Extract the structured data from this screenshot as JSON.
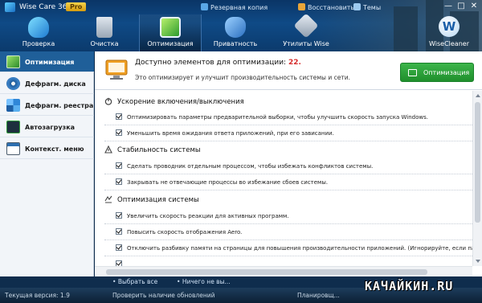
{
  "window": {
    "app_title": "Wise Care 365",
    "edition_badge": "Pro",
    "links": [
      "Резервная копия",
      "Восстановить",
      "Темы"
    ],
    "controls": [
      "—",
      "□",
      "✕"
    ]
  },
  "nav": {
    "items": [
      {
        "label": "Проверка",
        "icon": "shield-check-icon"
      },
      {
        "label": "Очистка",
        "icon": "trash-icon"
      },
      {
        "label": "Оптимизация",
        "icon": "monitor-tune-icon",
        "active": true
      },
      {
        "label": "Приватность",
        "icon": "privacy-shield-icon"
      },
      {
        "label": "Утилиты Wise",
        "icon": "tools-icon"
      }
    ],
    "brand": "WiseCleaner",
    "brand_letter": "W"
  },
  "sidebar": {
    "items": [
      {
        "label": "Оптимизация",
        "icon": "optimize-icon",
        "active": true
      },
      {
        "label": "Дефрагм. диска",
        "icon": "disk-defrag-icon"
      },
      {
        "label": "Дефрагм. реестра",
        "icon": "registry-defrag-icon"
      },
      {
        "label": "Автозагрузка",
        "icon": "startup-icon"
      },
      {
        "label": "Контекст. меню",
        "icon": "context-menu-icon"
      }
    ]
  },
  "summary": {
    "title": "Доступно элементов для оптимизации:",
    "count": "22.",
    "description": "Это оптимизирует и улучшит производительность системы и сети.",
    "button_label": "Оптимизация"
  },
  "sections": [
    {
      "title": "Ускорение включения/выключения",
      "icon": "power-icon",
      "options": [
        "Оптимизировать параметры предварительной выборки, чтобы улучшить скорость запуска Windows.",
        "Уменьшить время ожидания ответа приложений, при его зависании."
      ]
    },
    {
      "title": "Стабильность системы",
      "icon": "stability-icon",
      "options": [
        "Сделать проводник отдельным процессом, чтобы избежать конфликтов системы.",
        "Закрывать не отвечающие процессы во избежание сбоев системы."
      ]
    },
    {
      "title": "Оптимизация системы",
      "icon": "system-icon",
      "options": [
        "Увеличить скорость реакции для активных программ.",
        "Повысить скорость отображения Aero.",
        "Отключить разбивку памяти на страницы для повышения производительности приложений. (Игнорируйте, если памяти <"
      ]
    }
  ],
  "bottom_links": [
    "Выбрать все",
    "Ничего не вы..."
  ],
  "status": {
    "version": "Текущая версия: 1.9",
    "update": "Проверить наличие обновлений",
    "task": "Планировщ..."
  },
  "watermark": "КАЧАЙКИН.RU",
  "colors": {
    "header_bg": "#0f4a86",
    "sidebar_active": "#1f5f99",
    "count_red": "#d62c2c",
    "button_green": "#2aa23a"
  }
}
